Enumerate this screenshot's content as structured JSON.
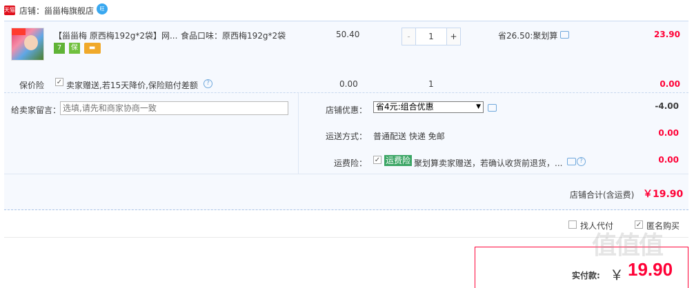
{
  "shop": {
    "badge": "天猫",
    "title": "店铺：甾甾梅旗舰店",
    "wangwang": "旺"
  },
  "item": {
    "title": "【甾甾梅 原西梅192g*2袋】网...",
    "sku": "食品口味：原西梅192g*2袋",
    "price": "50.40",
    "qty_minus": "-",
    "qty": "1",
    "qty_plus": "+",
    "promo": "省26.50:聚划算",
    "total": "23.90",
    "service_icons": [
      {
        "name": "7day-return-icon",
        "glyph": "7"
      },
      {
        "name": "guarantee-icon",
        "glyph": "保"
      },
      {
        "name": "credit-card-icon",
        "glyph": "▬"
      }
    ]
  },
  "insurance": {
    "label": "保价险",
    "check": "✓",
    "text": "卖家赠送,若15天降价,保险赔付差额",
    "help": "?",
    "price": "0.00",
    "qty": "1",
    "total": "0.00"
  },
  "message": {
    "label": "给卖家留言：",
    "placeholder": "选填,请先和商家协商一致"
  },
  "discount": {
    "label": "店铺优惠：",
    "selected": "省4元:组合优惠",
    "arrow": "▼",
    "total": "-4.00"
  },
  "shipping": {
    "label": "运送方式：",
    "text": "普通配送 快递 免邮",
    "total": "0.00"
  },
  "freight_insurance": {
    "label": "运费险：",
    "check": "✓",
    "badge": "运费险",
    "text": "聚划算卖家赠送，若确认收货前退货，...",
    "help": "?",
    "total": "0.00"
  },
  "shop_total": {
    "label": "店铺合计(含运费)",
    "value": "￥19.90"
  },
  "options": {
    "agent_label": "找人代付",
    "anon_label": "匿名购买",
    "anon_check": "✓"
  },
  "payment": {
    "label": "实付款:",
    "currency": "￥",
    "value": "19.90"
  },
  "watermark": "值值值",
  "colors": {
    "price_red": "#ff0036",
    "tmall_red": "#e0101c",
    "panel_bg": "#f6f9fe",
    "border_blue": "#c6d7ef",
    "freight_badge": "#3aa564"
  }
}
